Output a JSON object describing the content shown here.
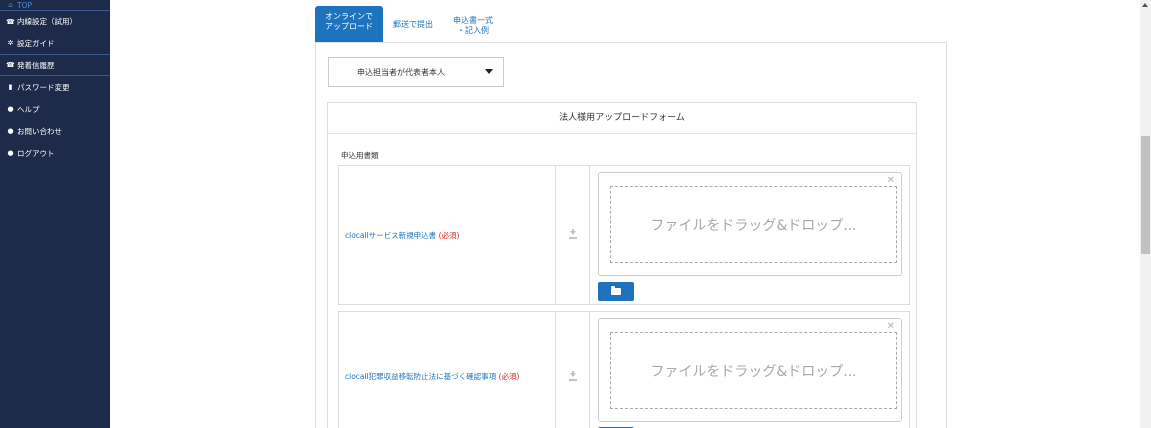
{
  "sidebar": {
    "items": [
      {
        "icon": "home-icon",
        "glyph": "⌂",
        "label": "TOP"
      },
      {
        "icon": "phone-icon",
        "glyph": "☎",
        "label": "内線設定（試用）"
      },
      {
        "icon": "gear-icon",
        "glyph": "✲",
        "label": "設定ガイド"
      },
      {
        "icon": "phone-icon",
        "glyph": "☎",
        "label": "発着信履歴"
      },
      {
        "icon": "lock-icon",
        "glyph": "▮",
        "label": "パスワード変更"
      },
      {
        "icon": "question-icon",
        "glyph": "●",
        "label": "ヘルプ"
      },
      {
        "icon": "external-link-icon",
        "glyph": "●",
        "label": "お問い合わせ"
      },
      {
        "icon": "logout-icon",
        "glyph": "●",
        "label": "ログアウト"
      }
    ]
  },
  "tabs": [
    {
      "line1": "オンラインで",
      "line2": "アップロード",
      "active": true
    },
    {
      "line1": "郵送で提出",
      "line2": "",
      "active": false
    },
    {
      "line1": "申込書一式",
      "line2": "・記入例",
      "active": false
    }
  ],
  "select": {
    "value": "申込担当者が代表者本人"
  },
  "form": {
    "title": "法人様用アップロードフォーム",
    "section_label": "申込用書類",
    "documents": [
      {
        "name": "clocallサービス新規申込書",
        "required_open": " (",
        "required": "必須",
        "required_close": ")"
      },
      {
        "name": "clocall犯罪収益移転防止法に基づく確認事項",
        "required_open": " (",
        "required": "必須",
        "required_close": ")"
      }
    ],
    "drop_text": "ファイルをドラッグ&ドロップ..."
  },
  "colors": {
    "sidebar_bg": "#1e2a4a",
    "accent": "#1e73be",
    "required": "#d9211b"
  }
}
